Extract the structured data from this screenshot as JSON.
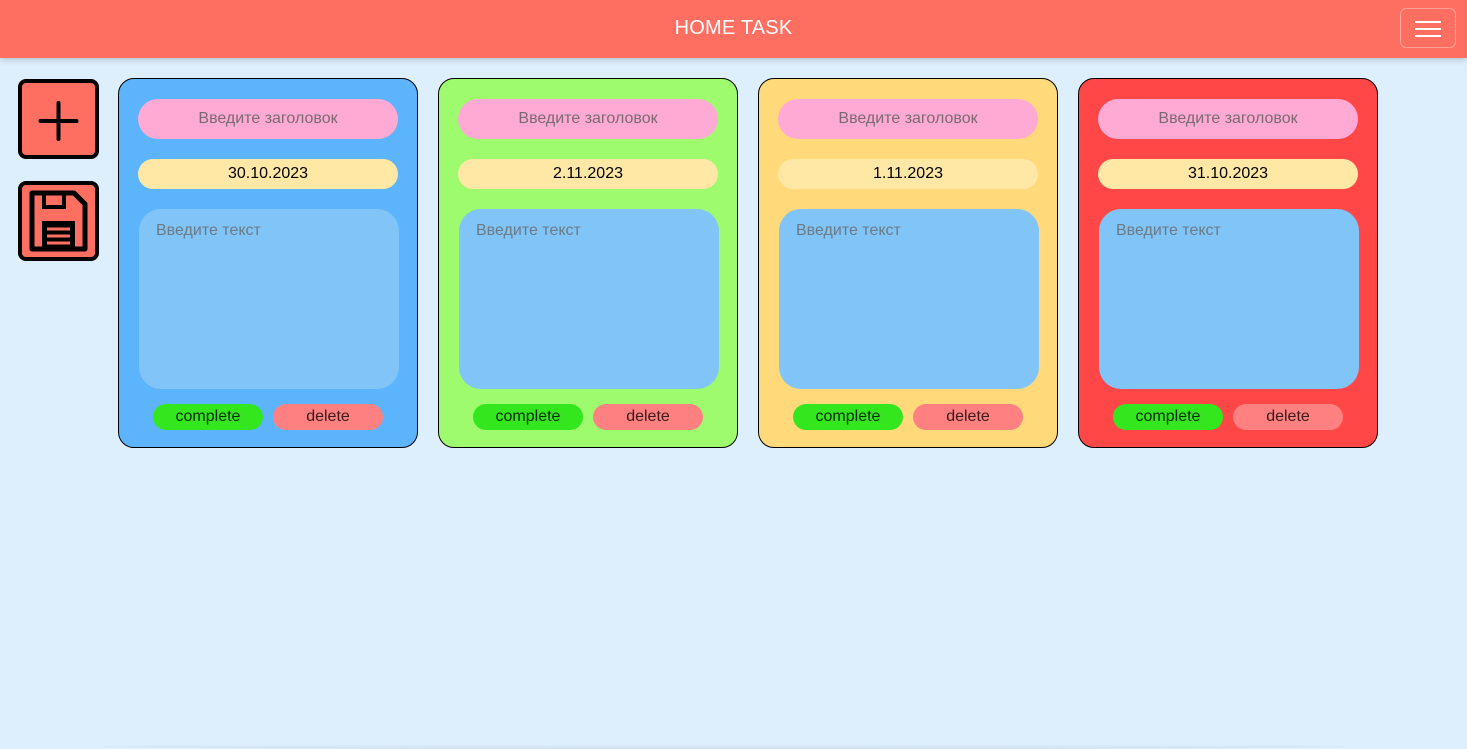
{
  "header": {
    "title": "HOME TASK",
    "background": "#ff6f61",
    "menu_icon": "hamburger-menu-icon"
  },
  "toolbar": {
    "add_icon": "plus-icon",
    "save_icon": "floppy-disk-icon",
    "button_color": "#ff6f61"
  },
  "cards": [
    {
      "color": "#5cb4fd",
      "title_placeholder": "Введите заголовок",
      "date": "30.10.2023",
      "text_placeholder": "Введите текст",
      "complete_label": "complete",
      "delete_label": "delete"
    },
    {
      "color": "#9efb6e",
      "title_placeholder": "Введите заголовок",
      "date": "2.11.2023",
      "text_placeholder": "Введите текст",
      "complete_label": "complete",
      "delete_label": "delete"
    },
    {
      "color": "#ffd97a",
      "title_placeholder": "Введите заголовок",
      "date": "1.11.2023",
      "text_placeholder": "Введите текст",
      "complete_label": "complete",
      "delete_label": "delete"
    },
    {
      "color": "#ff4747",
      "title_placeholder": "Введите заголовок",
      "date": "31.10.2023",
      "text_placeholder": "Введите текст",
      "complete_label": "complete",
      "delete_label": "delete"
    }
  ]
}
